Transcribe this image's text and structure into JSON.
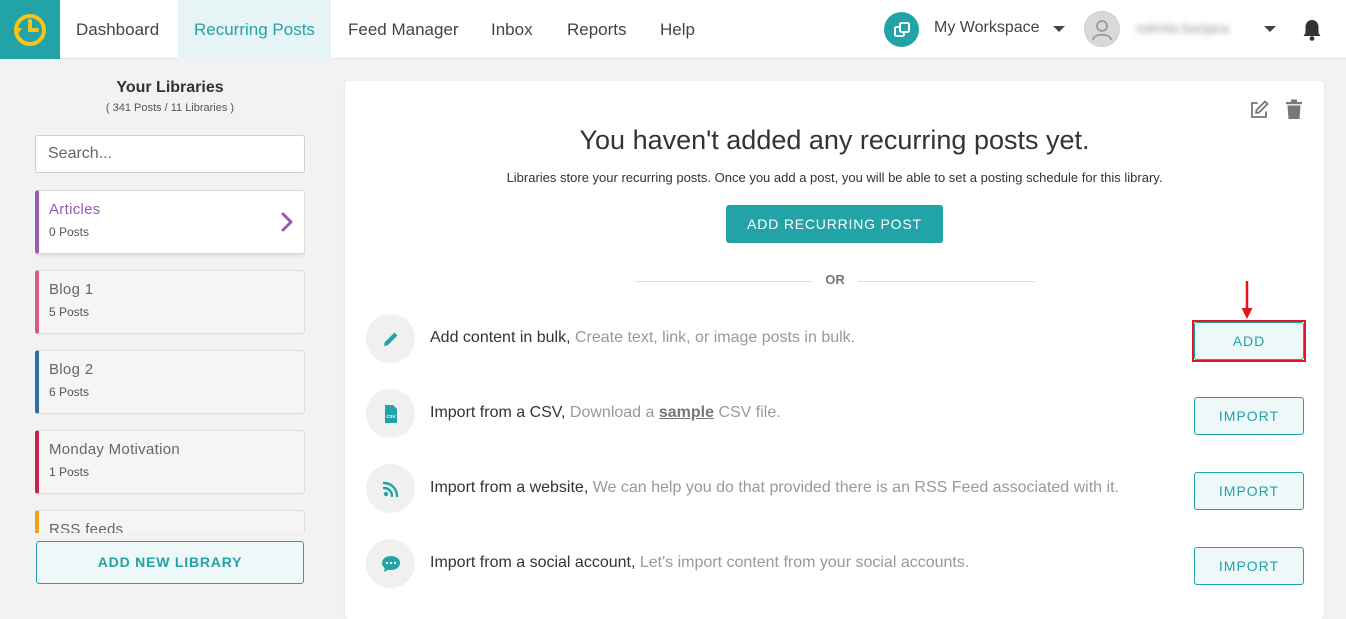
{
  "nav": {
    "items": [
      "Dashboard",
      "Recurring Posts",
      "Feed Manager",
      "Inbox",
      "Reports",
      "Help"
    ],
    "active": "Recurring Posts",
    "workspace": "My Workspace",
    "username": "nahnla banjara"
  },
  "sidebar": {
    "title": "Your Libraries",
    "subtitle": "( 341 Posts / 11 Libraries )",
    "search_placeholder": "Search...",
    "libraries": [
      {
        "name": "Articles",
        "count": "0 Posts",
        "color": "#9b59b6"
      },
      {
        "name": "Blog 1",
        "count": "5 Posts",
        "color": "#d45a8a"
      },
      {
        "name": "Blog 2",
        "count": "6 Posts",
        "color": "#2a6fa8"
      },
      {
        "name": "Monday Motivation",
        "count": "1 Posts",
        "color": "#c8254d"
      },
      {
        "name": "RSS feeds",
        "count": "",
        "color": "#f0a21a"
      }
    ],
    "add_library_label": "ADD NEW LIBRARY"
  },
  "main": {
    "empty_title": "You haven't added any recurring posts yet.",
    "empty_desc": "Libraries store your recurring posts. Once you add a post, you will be able to set a posting schedule for this library.",
    "add_post_label": "ADD RECURRING POST",
    "or_label": "OR",
    "options": [
      {
        "title": "Add content in bulk,",
        "hint": "Create text, link, or image posts in bulk.",
        "button": "ADD",
        "icon": "pencil-icon"
      },
      {
        "title": "Import from a CSV,",
        "hint_pre": "Download a",
        "hint_link": "sample",
        "hint_post": "CSV file.",
        "button": "IMPORT",
        "icon": "csv-file-icon"
      },
      {
        "title": "Import from a website,",
        "hint": "We can help you do that provided there is an RSS Feed associated with it.",
        "button": "IMPORT",
        "icon": "rss-icon"
      },
      {
        "title": "Import from a social account,",
        "hint": "Let's import content from your social accounts.",
        "button": "IMPORT",
        "icon": "chat-bubble-icon"
      }
    ]
  },
  "colors": {
    "accent": "#21a3a8",
    "highlight": "#e8141c"
  }
}
